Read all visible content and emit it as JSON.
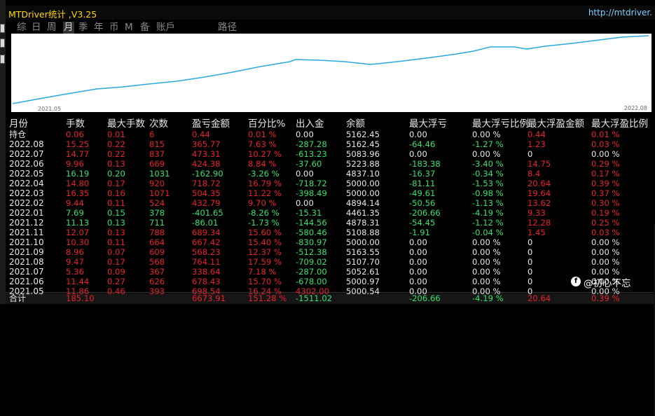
{
  "title": "MTDriver统计 ,V3.25",
  "url": "http://mtdriver.",
  "tabs": [
    "综",
    "日",
    "周",
    "月",
    "季",
    "年",
    "币",
    "M",
    "备",
    "账戶",
    "路径"
  ],
  "active_tab": 3,
  "chart": {
    "start_label": "2021.05",
    "end_label": "2022.08",
    "line_color": "#29a8e0",
    "background": "#ffffff"
  },
  "headers": [
    "月份",
    "手数",
    "最大手数",
    "次数",
    "盈亏金额",
    "百分比%",
    "出入金",
    "余额",
    "最大浮亏",
    "最大浮亏比例",
    "最大浮盈金额",
    "最大浮盈比例"
  ],
  "rows": [
    {
      "label": "持仓",
      "lots": "0.06",
      "maxlots": "0.01",
      "count": "6",
      "pl": "0.44",
      "pct": "0.01 %",
      "flow": "0.00",
      "bal": "5162.45",
      "fl": "0.00",
      "flp": "0.00 %",
      "fg": "0.44",
      "fgp": "0.01 %"
    },
    {
      "label": "2022.08",
      "lots": "15.25",
      "maxlots": "0.22",
      "count": "815",
      "pl": "365.77",
      "pct": "7.63 %",
      "flow": "-287.28",
      "bal": "5162.45",
      "fl": "-64.46",
      "flp": "-1.27 %",
      "fg": "1.23",
      "fgp": "0.03 %"
    },
    {
      "label": "2022.07",
      "lots": "14.77",
      "maxlots": "0.22",
      "count": "837",
      "pl": "473.31",
      "pct": "10.27 %",
      "flow": "-613.23",
      "bal": "5083.96",
      "fl": "0.00",
      "flp": "0.00 %",
      "fg": "0",
      "fgp": "0.00 %"
    },
    {
      "label": "2022.06",
      "lots": "9.96",
      "maxlots": "0.13",
      "count": "669",
      "pl": "424.38",
      "pct": "8.84 %",
      "flow": "-37.60",
      "bal": "5223.88",
      "fl": "-183.38",
      "flp": "-3.40 %",
      "fg": "14.75",
      "fgp": "0.29 %"
    },
    {
      "label": "2022.05",
      "lots": "16.19",
      "maxlots": "0.20",
      "count": "1031",
      "pl": "-162.90",
      "pct": "-3.26 %",
      "flow": "0.00",
      "bal": "4837.10",
      "fl": "-16.37",
      "flp": "-0.34 %",
      "fg": "8.4",
      "fgp": "0.17 %"
    },
    {
      "label": "2022.04",
      "lots": "14.80",
      "maxlots": "0.17",
      "count": "920",
      "pl": "718.72",
      "pct": "16.79 %",
      "flow": "-718.72",
      "bal": "5000.00",
      "fl": "-81.11",
      "flp": "-1.53 %",
      "fg": "20.64",
      "fgp": "0.39 %"
    },
    {
      "label": "2022.03",
      "lots": "16.35",
      "maxlots": "0.16",
      "count": "1071",
      "pl": "504.35",
      "pct": "11.22 %",
      "flow": "-398.49",
      "bal": "5000.00",
      "fl": "-49.61",
      "flp": "-0.98 %",
      "fg": "19.64",
      "fgp": "0.37 %"
    },
    {
      "label": "2022.02",
      "lots": "9.44",
      "maxlots": "0.11",
      "count": "524",
      "pl": "432.79",
      "pct": "9.70 %",
      "flow": "0.00",
      "bal": "4894.14",
      "fl": "-50.56",
      "flp": "-1.13 %",
      "fg": "13.62",
      "fgp": "0.30 %"
    },
    {
      "label": "2022.01",
      "lots": "7.69",
      "maxlots": "0.15",
      "count": "378",
      "pl": "-401.65",
      "pct": "-8.26 %",
      "flow": "-15.31",
      "bal": "4461.35",
      "fl": "-206.66",
      "flp": "-4.19 %",
      "fg": "9.33",
      "fgp": "0.19 %"
    },
    {
      "label": "2021.12",
      "lots": "11.13",
      "maxlots": "0.13",
      "count": "711",
      "pl": "-86.01",
      "pct": "-1.73 %",
      "flow": "-144.56",
      "bal": "4878.31",
      "fl": "-54.45",
      "flp": "-1.12 %",
      "fg": "12.28",
      "fgp": "0.25 %"
    },
    {
      "label": "2021.11",
      "lots": "12.07",
      "maxlots": "0.13",
      "count": "788",
      "pl": "689.34",
      "pct": "15.60 %",
      "flow": "-580.46",
      "bal": "5108.88",
      "fl": "-1.91",
      "flp": "-0.04 %",
      "fg": "1.45",
      "fgp": "0.03 %"
    },
    {
      "label": "2021.10",
      "lots": "10.30",
      "maxlots": "0.11",
      "count": "664",
      "pl": "667.42",
      "pct": "15.40 %",
      "flow": "-830.97",
      "bal": "5000.00",
      "fl": "0.00",
      "flp": "0.00 %",
      "fg": "0",
      "fgp": "0.00 %"
    },
    {
      "label": "2021.09",
      "lots": "8.96",
      "maxlots": "0.07",
      "count": "609",
      "pl": "568.23",
      "pct": "12.37 %",
      "flow": "-512.38",
      "bal": "5163.55",
      "fl": "0.00",
      "flp": "0.00 %",
      "fg": "0",
      "fgp": "0.00 %"
    },
    {
      "label": "2021.08",
      "lots": "9.47",
      "maxlots": "0.17",
      "count": "568",
      "pl": "764.11",
      "pct": "17.59 %",
      "flow": "-709.02",
      "bal": "5107.70",
      "fl": "0.00",
      "flp": "0.00 %",
      "fg": "0",
      "fgp": "0.00 %"
    },
    {
      "label": "2021.07",
      "lots": "5.36",
      "maxlots": "0.09",
      "count": "367",
      "pl": "338.64",
      "pct": "7.18 %",
      "flow": "-287.00",
      "bal": "5052.61",
      "fl": "0.00",
      "flp": "0.00 %",
      "fg": "0",
      "fgp": "0.00 %"
    },
    {
      "label": "2021.06",
      "lots": "11.44",
      "maxlots": "0.27",
      "count": "626",
      "pl": "678.43",
      "pct": "15.70 %",
      "flow": "-678.00",
      "bal": "5000.97",
      "fl": "0.00",
      "flp": "0.00 %",
      "fg": "0",
      "fgp": "0.00 %"
    },
    {
      "label": "2021.05",
      "lots": "11.86",
      "maxlots": "0.46",
      "count": "393",
      "pl": "698.54",
      "pct": "16.24 %",
      "flow": "4302.00",
      "bal": "5000.54",
      "fl": "0.00",
      "flp": "0.00 %",
      "fg": "0",
      "fgp": "0.00 %"
    }
  ],
  "totals": {
    "label": "合计",
    "lots": "185.10",
    "pl": "6673.91",
    "pct": "151.28 %",
    "flow": "-1511.02",
    "fl": "-206.66",
    "flp": "-4.19 %",
    "fg": "20.64",
    "fgp": "0.39 %"
  },
  "watermark": "@初心不忘"
}
